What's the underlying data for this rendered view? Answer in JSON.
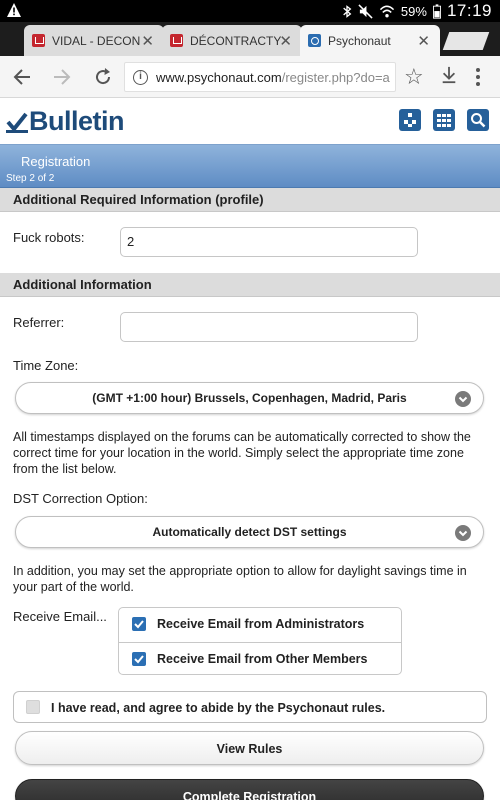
{
  "status_bar": {
    "battery_percent": "59%",
    "time": "17:19"
  },
  "tabs": [
    {
      "title": "VIDAL - DECON",
      "favicon": "vidal-favicon",
      "active": false
    },
    {
      "title": "DÉCONTRACTY",
      "favicon": "vidal-favicon",
      "active": false
    },
    {
      "title": "Psychonaut",
      "favicon": "psychonaut-favicon",
      "active": true
    }
  ],
  "url": {
    "host": "www.psychonaut.com",
    "path": "/register.php?do=a"
  },
  "site": {
    "logo_text": "Bulletin"
  },
  "registration": {
    "title": "Registration",
    "step": "Step 2 of 2"
  },
  "sections": {
    "required": "Additional Required Information (profile)",
    "additional": "Additional Information"
  },
  "fields": {
    "robots_label": "Fuck robots:",
    "robots_value": "2",
    "referrer_label": "Referrer:",
    "referrer_value": "",
    "timezone_label": "Time Zone:",
    "timezone_value": "(GMT +1:00 hour) Brussels, Copenhagen, Madrid, Paris",
    "timezone_help": "All timestamps displayed on the forums can be automatically corrected to show the correct time for your location in the world. Simply select the appropriate time zone from the list below.",
    "dst_label": "DST Correction Option:",
    "dst_value": "Automatically detect DST settings",
    "dst_help": "In addition, you may set the appropriate option to allow for daylight savings time in your part of the world.",
    "email_label": "Receive Email...",
    "email_admin": "Receive Email from Administrators",
    "email_admin_checked": true,
    "email_members": "Receive Email from Other Members",
    "email_members_checked": true,
    "agree_text": "I have read, and agree to abide by the Psychonaut rules.",
    "agree_checked": false
  },
  "buttons": {
    "view_rules": "View Rules",
    "complete": "Complete Registration"
  },
  "colors": {
    "banner": "#5e8cc4",
    "logo": "#1e4b7a",
    "checkbox": "#2b6fb4"
  }
}
